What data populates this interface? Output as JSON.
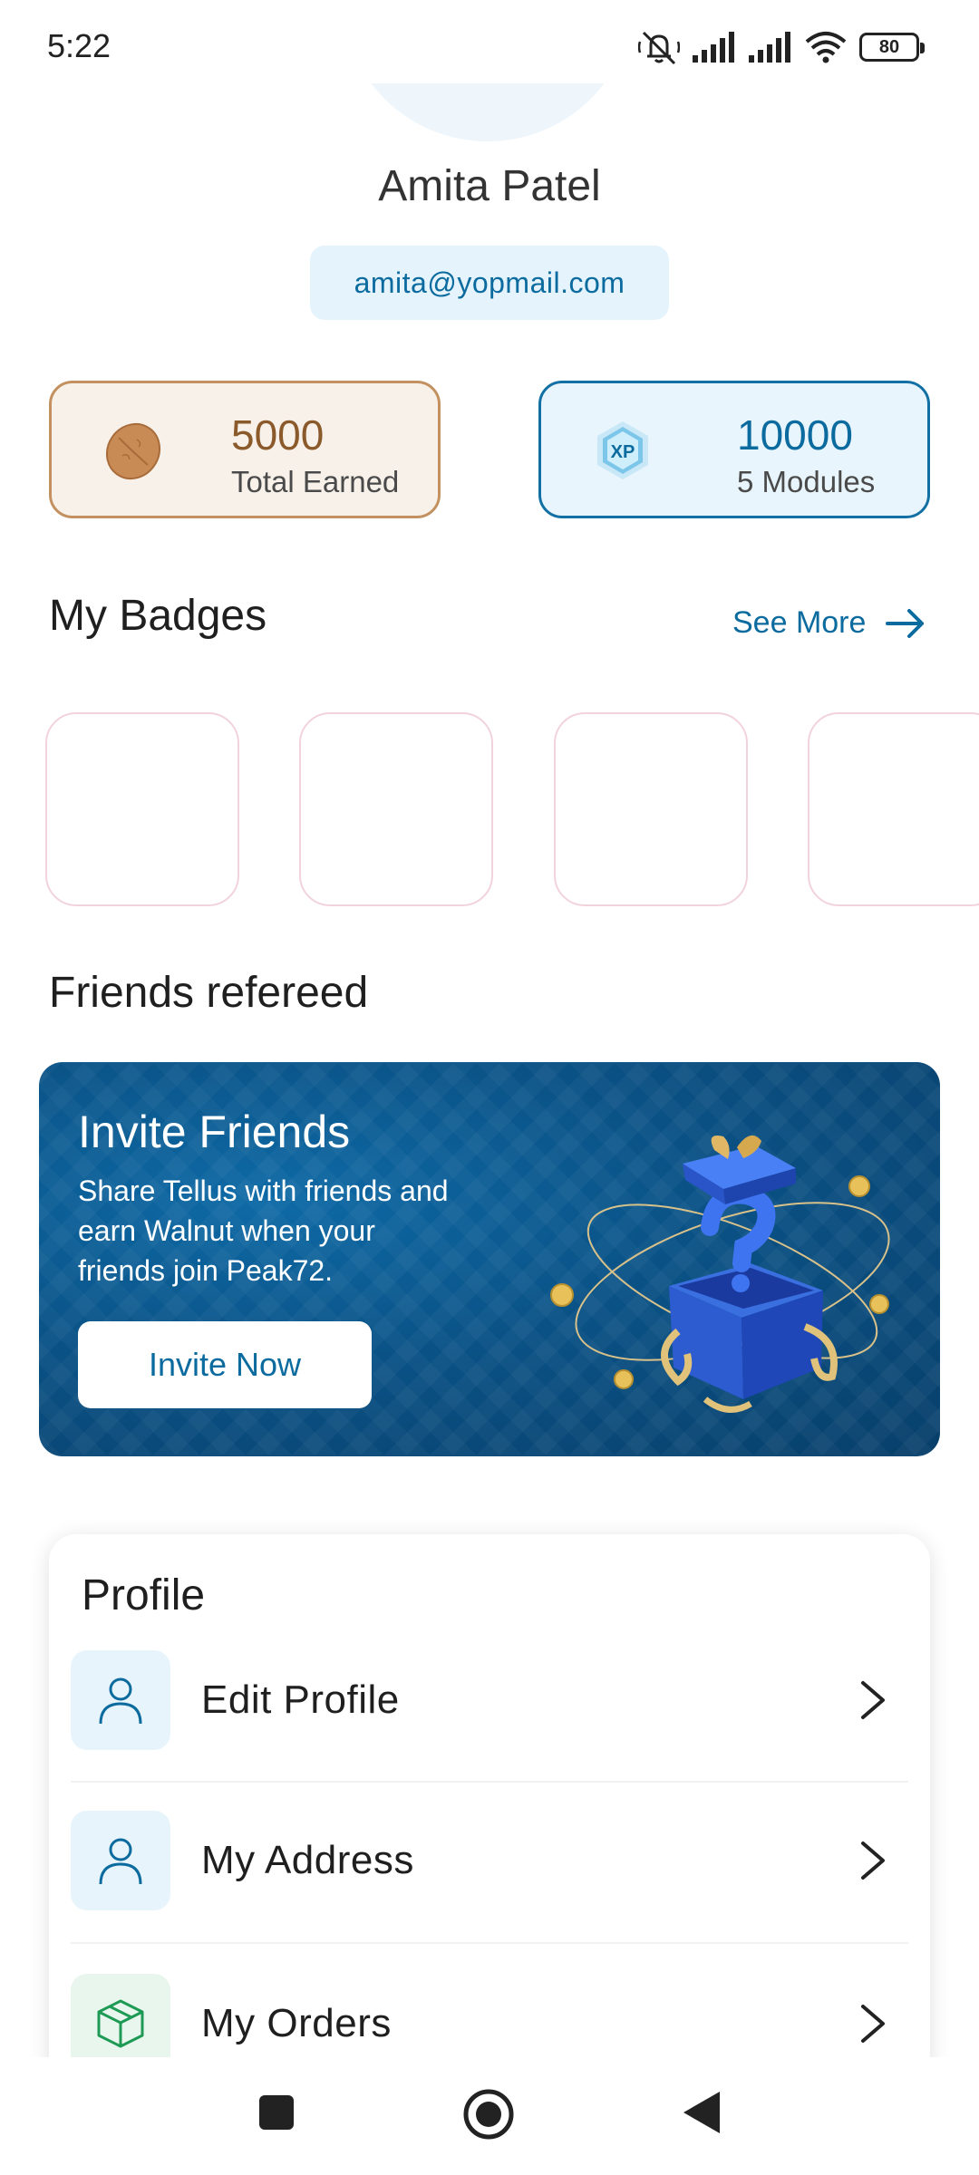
{
  "status_bar": {
    "time": "5:22",
    "battery_level": "80",
    "icons": [
      "mute-icon",
      "signal-icon",
      "signal-icon",
      "wifi-icon",
      "battery-icon"
    ]
  },
  "profile_header": {
    "name": "Amita Patel",
    "email": "amita@yopmail.com"
  },
  "stats": {
    "earned_value": "5000",
    "earned_label": "Total Earned",
    "earned_icon": "walnut-icon",
    "xp_value": "10000",
    "xp_label": "5 Modules",
    "xp_icon": "xp-icon",
    "xp_icon_text": "XP"
  },
  "badges": {
    "heading": "My Badges",
    "see_more": "See More"
  },
  "friends": {
    "heading": "Friends refereed",
    "banner_title": "Invite Friends",
    "banner_text": "Share Tellus with friends and earn Walnut when your friends join Peak72.",
    "invite_button": "Invite Now"
  },
  "profile_menu": {
    "title": "Profile",
    "items": [
      {
        "label": "Edit Profile",
        "icon": "user-icon"
      },
      {
        "label": "My Address",
        "icon": "user-icon"
      },
      {
        "label": "My Orders",
        "icon": "box-icon"
      }
    ]
  },
  "colors": {
    "brand_blue": "#0b6b9f",
    "walnut_brown": "#8b5a2b",
    "badge_border": "#f2d3dc"
  }
}
